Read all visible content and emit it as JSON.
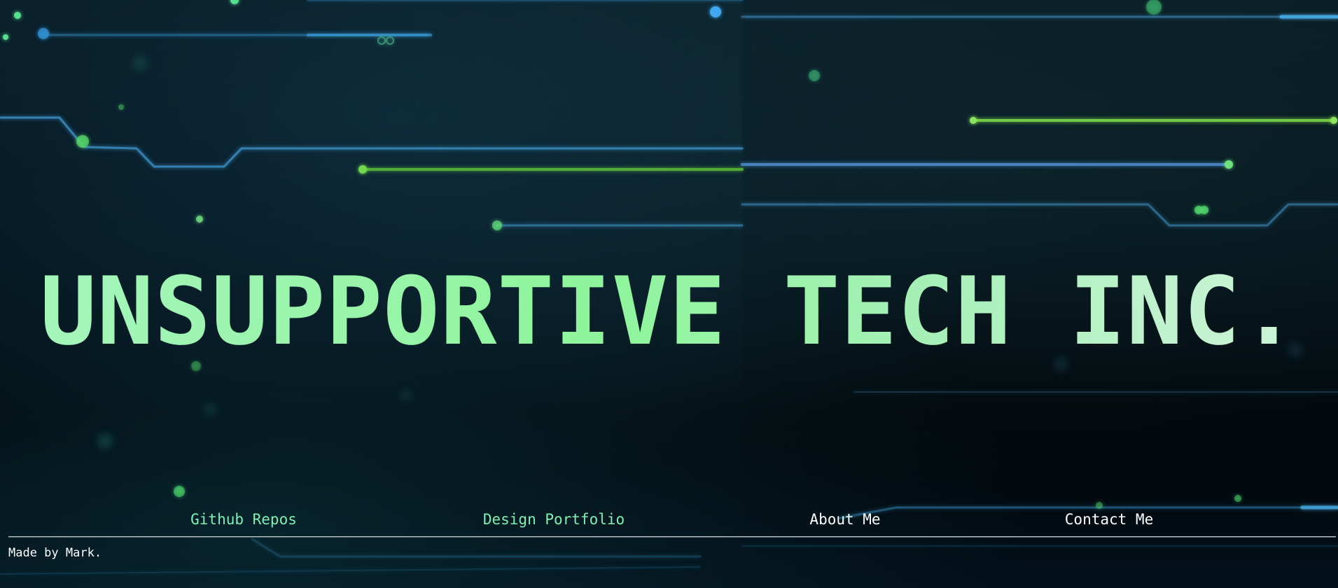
{
  "hero": {
    "title": "UNSUPPORTIVE TECH INC."
  },
  "nav": {
    "links": [
      {
        "label": "Github Repos",
        "color": "#7ff0b4"
      },
      {
        "label": "Design Portfolio",
        "color": "#7ff0b4"
      },
      {
        "label": "About Me",
        "color": "#ffffff"
      },
      {
        "label": "Contact Me",
        "color": "#ffffff"
      }
    ]
  },
  "footer": {
    "text": "Made by Mark."
  },
  "theme": {
    "background": "#02070c",
    "circuit_blue": "#3aa0d8",
    "circuit_green": "#6fe04a",
    "title_gradient": [
      "#a6f5bd",
      "#8ef59b",
      "#d2f4dc"
    ]
  }
}
